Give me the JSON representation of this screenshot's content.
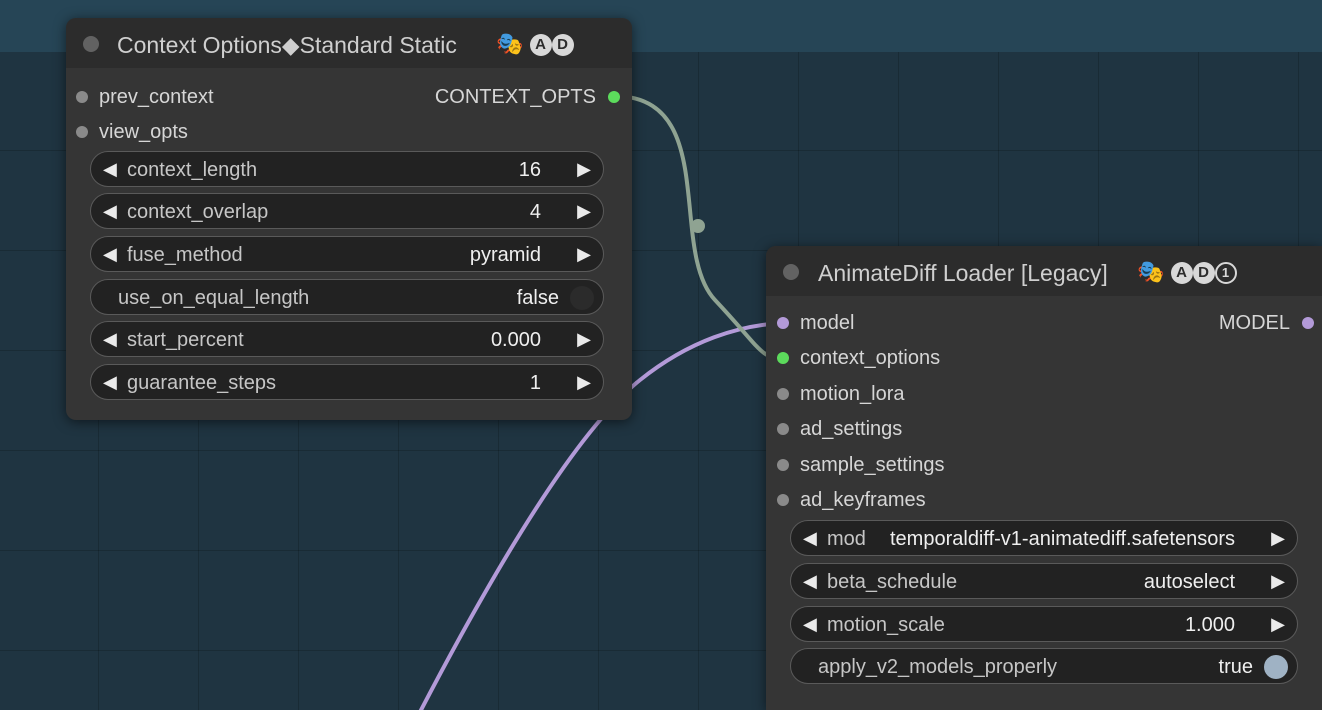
{
  "colors": {
    "canvas_bg": "#1f3441",
    "node_bg": "#353535",
    "node_header_bg": "#2c2c2c",
    "context_link": "#8fa392",
    "model_link": "#b39ad8",
    "slot_context": "#5cdb5c",
    "slot_model": "#b39ad8",
    "slot_default": "#8a8a8a"
  },
  "context_node": {
    "title": "Context Options◆Standard Static",
    "icons": [
      "performing-arts-icon",
      "badge-a-icon",
      "badge-d-icon"
    ],
    "badge_a": "A",
    "badge_d": "D",
    "inputs": [
      {
        "label": "prev_context"
      },
      {
        "label": "view_opts"
      }
    ],
    "output": {
      "label": "CONTEXT_OPTS"
    },
    "widgets": [
      {
        "label": "context_length",
        "value": "16",
        "type": "number"
      },
      {
        "label": "context_overlap",
        "value": "4",
        "type": "number"
      },
      {
        "label": "fuse_method",
        "value": "pyramid",
        "type": "combo"
      },
      {
        "label": "use_on_equal_length",
        "value": "false",
        "type": "toggle"
      },
      {
        "label": "start_percent",
        "value": "0.000",
        "type": "number"
      },
      {
        "label": "guarantee_steps",
        "value": "1",
        "type": "number"
      }
    ]
  },
  "animatediff_node": {
    "title": "AnimateDiff Loader [Legacy]",
    "icons": [
      "performing-arts-icon",
      "badge-a-icon",
      "badge-d-icon",
      "badge-1-icon"
    ],
    "badge_a": "A",
    "badge_d": "D",
    "badge_1": "1",
    "inputs": [
      {
        "label": "model"
      },
      {
        "label": "context_options"
      },
      {
        "label": "motion_lora"
      },
      {
        "label": "ad_settings"
      },
      {
        "label": "sample_settings"
      },
      {
        "label": "ad_keyframes"
      }
    ],
    "output": {
      "label": "MODEL"
    },
    "widgets": [
      {
        "label": "model_name",
        "label_visible": "mod",
        "value": "temporaldiff-v1-animatediff.safetensors",
        "type": "combo"
      },
      {
        "label": "beta_schedule",
        "value": "autoselect",
        "type": "combo"
      },
      {
        "label": "motion_scale",
        "value": "1.000",
        "type": "number"
      },
      {
        "label": "apply_v2_models_properly",
        "value": "true",
        "type": "toggle"
      }
    ]
  }
}
